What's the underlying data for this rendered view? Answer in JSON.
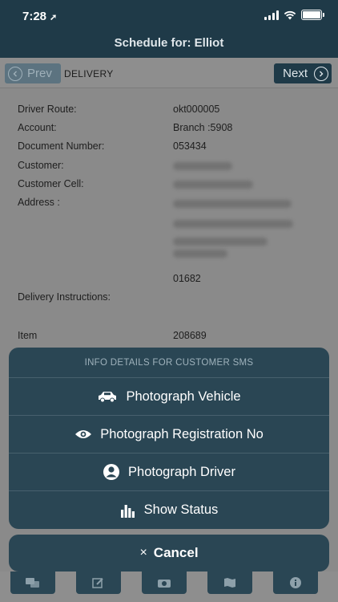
{
  "status_bar": {
    "time": "7:28",
    "location_glyph": "➚"
  },
  "header": {
    "title": "Schedule for: Elliot"
  },
  "nav": {
    "prev_label": "Prev",
    "title": "DELIVERY",
    "next_label": "Next"
  },
  "details": {
    "driver_route": {
      "label": "Driver Route:",
      "value": "okt000005"
    },
    "account": {
      "label": "Account:",
      "value": "Branch :5908"
    },
    "document_number": {
      "label": "Document Number:",
      "value": "053434"
    },
    "customer": {
      "label": "Customer:"
    },
    "customer_cell": {
      "label": "Customer Cell:"
    },
    "address": {
      "label": "Address :",
      "postal_code": "01682"
    },
    "delivery_instructions": {
      "label": "Delivery Instructions:"
    },
    "item": {
      "label": "Item",
      "value": "208689"
    }
  },
  "sheet": {
    "title": "INFO DETAILS FOR CUSTOMER SMS",
    "items": [
      {
        "label": "Photograph Vehicle",
        "icon": "car-icon"
      },
      {
        "label": "Photograph Registration No",
        "icon": "eye-icon"
      },
      {
        "label": "Photograph Driver",
        "icon": "user-circle-icon"
      },
      {
        "label": "Show Status",
        "icon": "bar-chart-icon"
      }
    ],
    "cancel_label": "Cancel",
    "cancel_glyph": "×"
  },
  "tabs": [
    {
      "icon": "chat-icon"
    },
    {
      "icon": "edit-icon"
    },
    {
      "icon": "camera-icon"
    },
    {
      "icon": "map-icon"
    },
    {
      "icon": "info-icon"
    }
  ]
}
